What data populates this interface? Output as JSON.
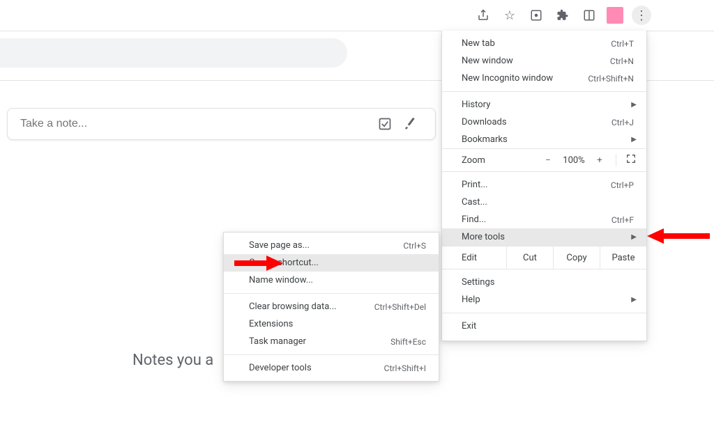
{
  "toolbar": {
    "share_icon": "share-icon",
    "star_icon": "star-icon",
    "google_icon": "apps-icon",
    "extension_icon": "puzzle-icon",
    "reader_icon": "reader-icon",
    "profile_icon": "profile-pink",
    "kebab_icon": "kebab-menu"
  },
  "keep": {
    "placeholder": "Take a note...",
    "checkbox_tool": "New list",
    "brush_tool": "New drawing",
    "heading": "Notes you a"
  },
  "menu": {
    "group1": [
      {
        "label": "New tab",
        "shortcut": "Ctrl+T"
      },
      {
        "label": "New window",
        "shortcut": "Ctrl+N"
      },
      {
        "label": "New Incognito window",
        "shortcut": "Ctrl+Shift+N"
      }
    ],
    "group2": [
      {
        "label": "History",
        "shortcut": "",
        "submenu": true
      },
      {
        "label": "Downloads",
        "shortcut": "Ctrl+J"
      },
      {
        "label": "Bookmarks",
        "shortcut": "",
        "submenu": true
      }
    ],
    "zoom": {
      "label": "Zoom",
      "minus": "−",
      "value": "100%",
      "plus": "+",
      "fullscreen": "⛶"
    },
    "group3": [
      {
        "label": "Print...",
        "shortcut": "Ctrl+P"
      },
      {
        "label": "Cast...",
        "shortcut": ""
      },
      {
        "label": "Find...",
        "shortcut": "Ctrl+F"
      },
      {
        "label": "More tools",
        "shortcut": "",
        "submenu": true,
        "highlight": true
      }
    ],
    "edit": {
      "label": "Edit",
      "cut": "Cut",
      "copy": "Copy",
      "paste": "Paste"
    },
    "group4": [
      {
        "label": "Settings",
        "shortcut": ""
      },
      {
        "label": "Help",
        "shortcut": "",
        "submenu": true
      }
    ],
    "group5": [
      {
        "label": "Exit",
        "shortcut": ""
      }
    ]
  },
  "submenu": {
    "group1": [
      {
        "label": "Save page as...",
        "shortcut": "Ctrl+S"
      },
      {
        "label": "Create shortcut...",
        "shortcut": "",
        "highlight": true
      },
      {
        "label": "Name window...",
        "shortcut": ""
      }
    ],
    "group2": [
      {
        "label": "Clear browsing data...",
        "shortcut": "Ctrl+Shift+Del"
      },
      {
        "label": "Extensions",
        "shortcut": ""
      },
      {
        "label": "Task manager",
        "shortcut": "Shift+Esc"
      }
    ],
    "group3": [
      {
        "label": "Developer tools",
        "shortcut": "Ctrl+Shift+I"
      }
    ]
  }
}
